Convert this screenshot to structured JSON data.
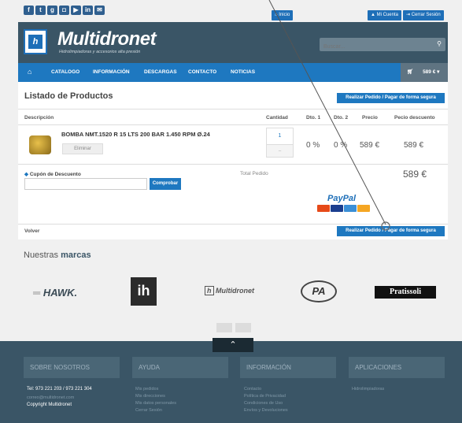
{
  "topbar": {
    "social_icons": [
      "facebook-icon",
      "twitter-icon",
      "google-plus-icon",
      "instagram-icon",
      "youtube-icon",
      "linkedin-icon",
      "mail-icon"
    ],
    "inicio": "Inicio",
    "mi_cuenta": "Mi Cuenta",
    "cerrar_sesion": "Cerrar Sesión"
  },
  "header": {
    "logo_text": "Multidronet",
    "logo_sub": "Hidrolimpiadoras y accesorios alta presión",
    "search_placeholder": "Buscar..."
  },
  "nav": {
    "items": [
      "CATALOGO",
      "INFORMACIÓN",
      "DESCARGAS",
      "CONTACTO",
      "NOTICIAS"
    ],
    "cart_total": "589 €"
  },
  "cart": {
    "title": "Listado de Productos",
    "checkout_label": "Realizar Pedido / Pagar de forma segura",
    "columns": [
      "Descripción",
      "Cantidad",
      "Dto. 1",
      "Dto. 2",
      "Precio",
      "Pecio descuento"
    ],
    "product": {
      "name": "BOMBA NMT.1520 R 15 LTS 200 BAR 1.450 RPM Ø.24",
      "delete_label": "Eliminar",
      "quantity": "1",
      "dto1": "0 %",
      "dto2": "0 %",
      "price": "589 €",
      "discount_price": "589 €"
    },
    "coupon_label": "Cupón de Descuento",
    "coupon_value": "",
    "coupon_button": "Comprobar",
    "total_label": "Total Pedido",
    "total_value": "589 €",
    "paypal_label": "PayPal",
    "back_label": "Volver"
  },
  "brands": {
    "title_pre": "Nuestras ",
    "title_bold": "marcas",
    "items": [
      "HAWK.",
      "ih",
      "Multidronet",
      "PA",
      "Pratissoli"
    ]
  },
  "footer": {
    "sections": [
      "SOBRE NOSOTROS",
      "AYUDA",
      "INFORMACIÓN",
      "APLICACIONES"
    ],
    "phone": "Tel: 973 221 203 / 973 221 304",
    "email": "correo@multidronet.com",
    "copyright": "Copyright Multidronet",
    "ayuda_links": [
      "Mis pedidos",
      "Mis direcciones",
      "Mis datos personales",
      "Cerrar Sesión"
    ],
    "info_links": [
      "Contacto",
      "Política de Privacidad",
      "Condiciones de Uso",
      "Envíos y Devoluciones"
    ],
    "app_links": [
      "Hidrolimpiadoras"
    ]
  },
  "colors": {
    "header_bg": "#3a5566",
    "nav_bg": "#1e78c0",
    "accent": "#1e78c0"
  }
}
